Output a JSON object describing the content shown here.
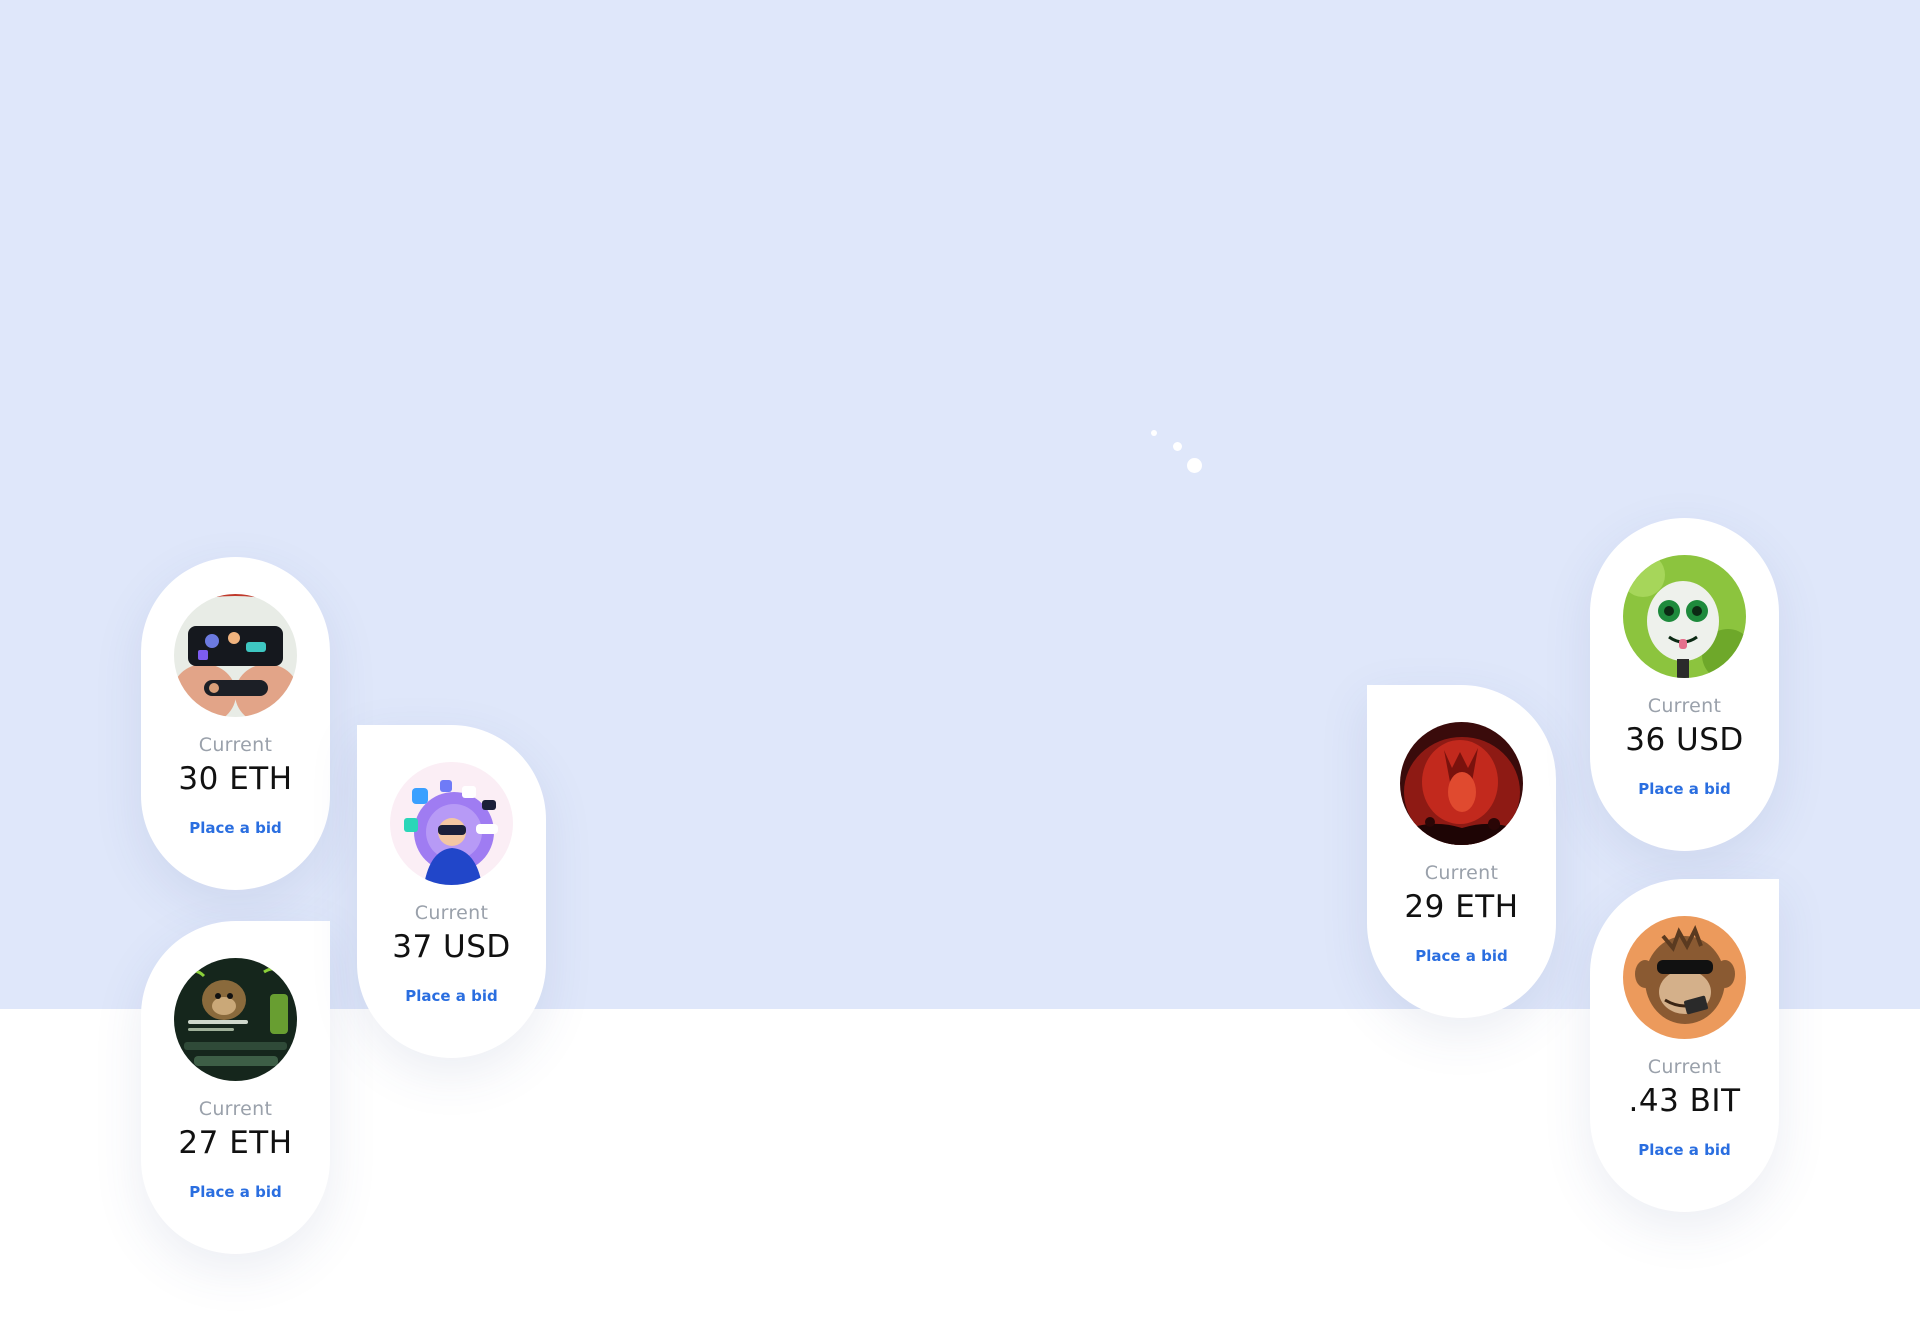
{
  "colors": {
    "hero_background": "#dfe7fa",
    "card_background": "#ffffff",
    "label_gray": "#9aa1ab",
    "value_black": "#111111",
    "link_blue": "#2a6ee0"
  },
  "cards": [
    {
      "label": "Current",
      "value": "30 ETH",
      "action": "Place a bid",
      "image": "vr-phone-nft"
    },
    {
      "label": "Current",
      "value": "27 ETH",
      "action": "Place a bid",
      "image": "ape-marketplace-nft"
    },
    {
      "label": "Current",
      "value": "37 USD",
      "action": "Place a bid",
      "image": "vr-headset-person-nft"
    },
    {
      "label": "Current",
      "value": "29 ETH",
      "action": "Place a bid",
      "image": "red-demon-nft"
    },
    {
      "label": "Current",
      "value": "36 USD",
      "action": "Place a bid",
      "image": "green-monster-nft"
    },
    {
      "label": "Current",
      "value": ".43 BIT",
      "action": "Place a bid",
      "image": "bored-ape-nft"
    }
  ]
}
